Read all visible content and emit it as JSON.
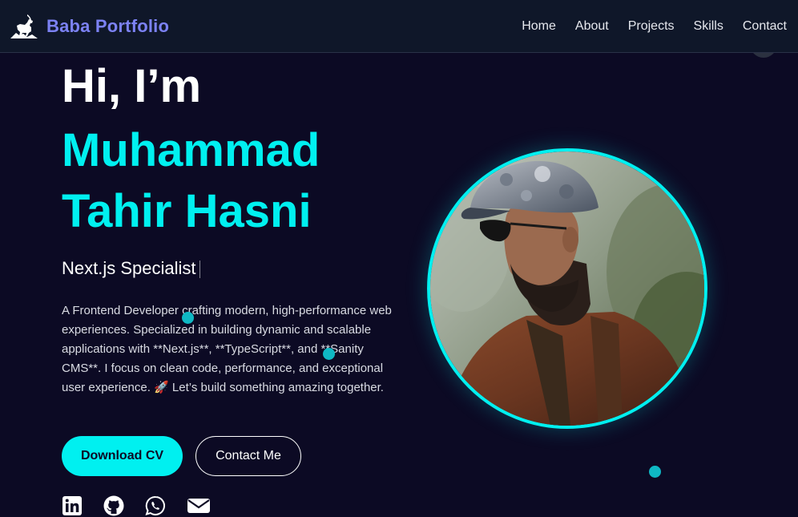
{
  "nav": {
    "brand": "Baba Portfolio",
    "brand_logo": "goat-logo-icon",
    "links": [
      "Home",
      "About",
      "Projects",
      "Skills",
      "Contact"
    ]
  },
  "hero": {
    "greeting": "Hi, I’m",
    "name": "Muhammad Tahir Hasni",
    "role": "Next.js Specialist",
    "bio": "A Frontend Developer crafting modern, high-performance web experiences. Specialized in building dynamic and scalable applications with **Next.js**, **TypeScript**, and **Sanity CMS**. I focus on clean code, performance, and exceptional user experience. 🚀 Let’s build something amazing together.",
    "download_cv": "Download CV",
    "contact_me": "Contact Me"
  },
  "socials": [
    "linkedin-icon",
    "github-icon",
    "whatsapp-icon",
    "email-icon"
  ],
  "colors": {
    "background": "#0c0a24",
    "navbar": "#0f1729",
    "accent": "#00f0f0",
    "brand": "#7c82f4",
    "dot": "#0fb8c4"
  }
}
